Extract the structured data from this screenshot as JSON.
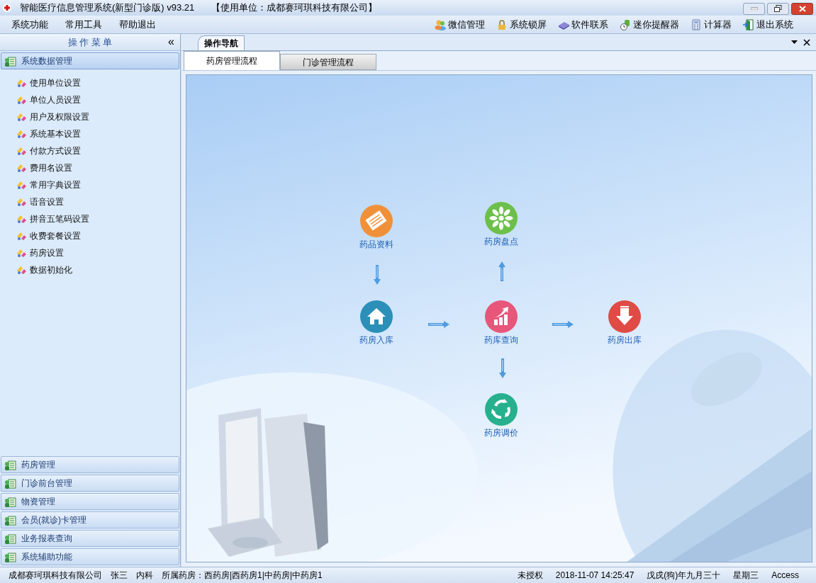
{
  "window": {
    "title": "智能医疗信息管理系统(新型门诊版) v93.21",
    "unit": "【使用单位：成都赛珂琪科技有限公司】"
  },
  "menu": [
    "系统功能",
    "常用工具",
    "帮助退出"
  ],
  "toolbar": [
    {
      "label": "微信管理",
      "kind": "people"
    },
    {
      "label": "系统锁屏",
      "kind": "lock"
    },
    {
      "label": "软件联系",
      "kind": "book"
    },
    {
      "label": "迷你提醒器",
      "kind": "clock"
    },
    {
      "label": "计算器",
      "kind": "calc"
    },
    {
      "label": "退出系统",
      "kind": "exit"
    }
  ],
  "sidebar": {
    "title": "操 作 菜 单",
    "collapse": "«",
    "groups": [
      {
        "label": "系统数据管理",
        "selected": true,
        "items": [
          "使用单位设置",
          "单位人员设置",
          "用户及权限设置",
          "系统基本设置",
          "付款方式设置",
          "费用名设置",
          "常用字典设置",
          "语音设置",
          "拼音五笔码设置",
          "收费套餐设置",
          "药房设置",
          "数据初始化"
        ]
      },
      {
        "label": "药房管理",
        "selected": false
      },
      {
        "label": "门诊前台管理",
        "selected": false
      },
      {
        "label": "物资管理",
        "selected": false
      },
      {
        "label": "会员(就诊)卡管理",
        "selected": false
      },
      {
        "label": "业务报表查询",
        "selected": false
      },
      {
        "label": "系统辅助功能",
        "selected": false
      }
    ]
  },
  "doc_tabs": [
    {
      "label": "操作导航",
      "selected": true
    }
  ],
  "tabs": [
    {
      "label": "药房管理流程",
      "selected": true
    },
    {
      "label": "门诊管理流程",
      "selected": false
    }
  ],
  "flow": [
    {
      "label": "药品资料",
      "kind": "docs",
      "color": "#f0913a"
    },
    {
      "label": "药房盘点",
      "kind": "flower",
      "color": "#6cc04a"
    },
    {
      "label": "药房入库",
      "kind": "house",
      "color": "#2b8fb8"
    },
    {
      "label": "药库查询",
      "kind": "chart",
      "color": "#e8567a"
    },
    {
      "label": "药房出库",
      "kind": "down",
      "color": "#e04b45"
    },
    {
      "label": "药房调价",
      "kind": "recycle",
      "color": "#27b08e"
    }
  ],
  "status_bar": [
    "成都赛珂琪科技有限公司",
    "张三",
    "内科",
    "所属药房：西药房|西药房1|中药房|中药房1",
    "未授权",
    "2018-11-07 14:25:47",
    "戊戌(狗)年九月三十",
    "星期三",
    "Access"
  ]
}
